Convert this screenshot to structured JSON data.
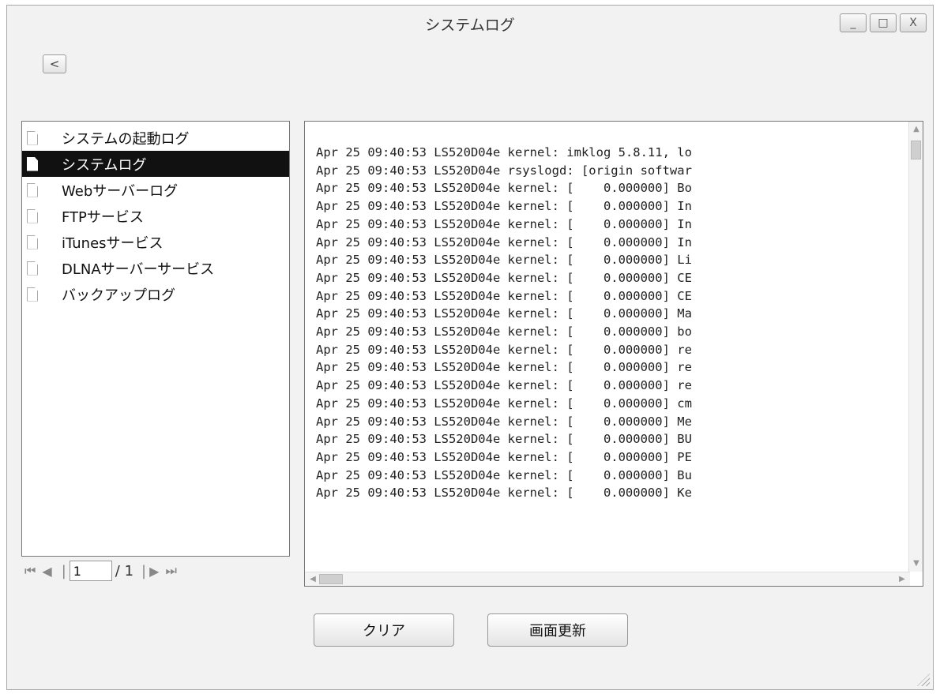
{
  "window": {
    "title": "システムログ",
    "controls": [
      "_",
      "□",
      "X"
    ]
  },
  "toolbar": {
    "back_label": "<"
  },
  "sidebar": {
    "items": [
      {
        "label": "システムの起動ログ",
        "selected": false
      },
      {
        "label": "システムログ",
        "selected": true
      },
      {
        "label": "Webサーバーログ",
        "selected": false
      },
      {
        "label": "FTPサービス",
        "selected": false
      },
      {
        "label": "iTunesサービス",
        "selected": false
      },
      {
        "label": "DLNAサーバーサービス",
        "selected": false
      },
      {
        "label": "バックアップログ",
        "selected": false
      }
    ]
  },
  "pager": {
    "page_value": "1",
    "total_label": "/ 1"
  },
  "log": {
    "lines": [
      "Apr 25 09:40:53 LS520D04e kernel: imklog 5.8.11, lo",
      "Apr 25 09:40:53 LS520D04e rsyslogd: [origin softwar",
      "Apr 25 09:40:53 LS520D04e kernel: [    0.000000] Bo",
      "Apr 25 09:40:53 LS520D04e kernel: [    0.000000] In",
      "Apr 25 09:40:53 LS520D04e kernel: [    0.000000] In",
      "Apr 25 09:40:53 LS520D04e kernel: [    0.000000] In",
      "Apr 25 09:40:53 LS520D04e kernel: [    0.000000] Li",
      "Apr 25 09:40:53 LS520D04e kernel: [    0.000000] CE",
      "Apr 25 09:40:53 LS520D04e kernel: [    0.000000] CE",
      "Apr 25 09:40:53 LS520D04e kernel: [    0.000000] Ma",
      "Apr 25 09:40:53 LS520D04e kernel: [    0.000000] bo",
      "Apr 25 09:40:53 LS520D04e kernel: [    0.000000] re",
      "Apr 25 09:40:53 LS520D04e kernel: [    0.000000] re",
      "Apr 25 09:40:53 LS520D04e kernel: [    0.000000] re",
      "Apr 25 09:40:53 LS520D04e kernel: [    0.000000] cm",
      "Apr 25 09:40:53 LS520D04e kernel: [    0.000000] Me",
      "Apr 25 09:40:53 LS520D04e kernel: [    0.000000] BU",
      "Apr 25 09:40:53 LS520D04e kernel: [    0.000000] PE",
      "Apr 25 09:40:53 LS520D04e kernel: [    0.000000] Bu",
      "Apr 25 09:40:53 LS520D04e kernel: [    0.000000] Ke"
    ]
  },
  "actions": {
    "clear_label": "クリア",
    "refresh_label": "画面更新"
  }
}
